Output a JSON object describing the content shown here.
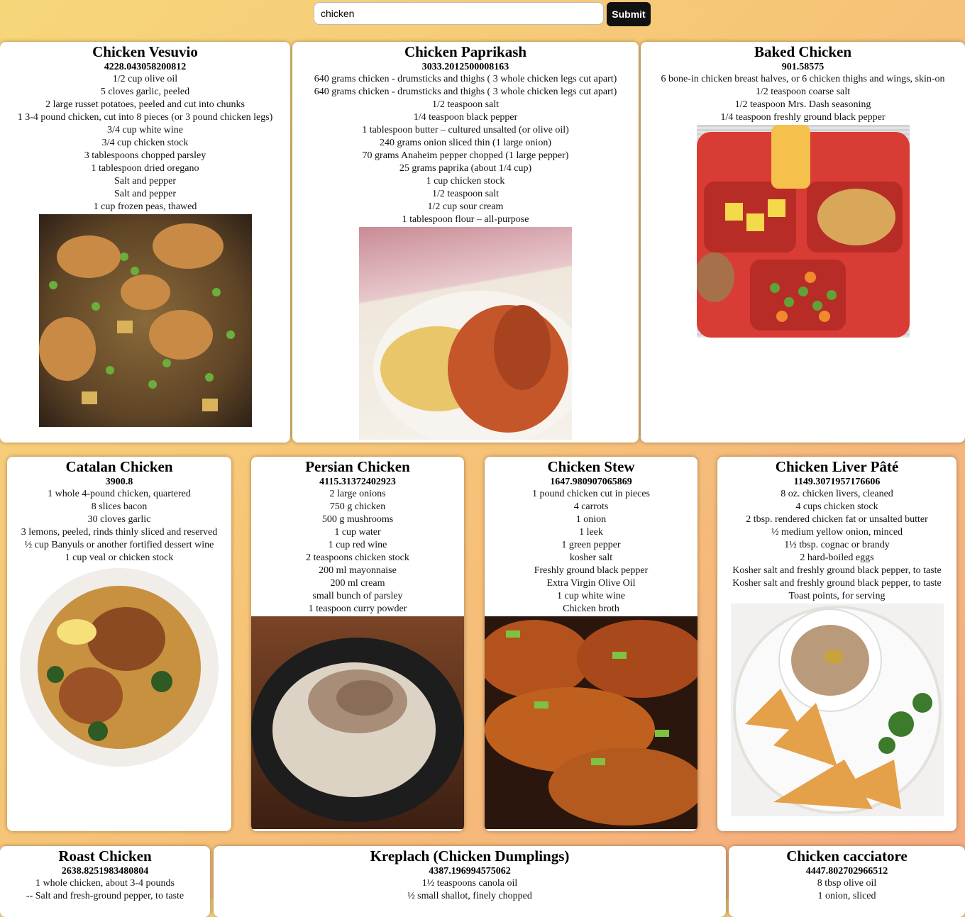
{
  "search": {
    "value": "chicken",
    "submit_label": "Submit"
  },
  "recipes": [
    {
      "title": "Chicken Vesuvio",
      "score": "4228.043058200812",
      "ingredients": [
        "1/2 cup olive oil",
        "5 cloves garlic, peeled",
        "2 large russet potatoes, peeled and cut into chunks",
        "1 3-4 pound chicken, cut into 8 pieces (or 3 pound chicken legs)",
        "3/4 cup white wine",
        "3/4 cup chicken stock",
        "3 tablespoons chopped parsley",
        "1 tablespoon dried oregano",
        "Salt and pepper",
        "Salt and pepper",
        "1 cup frozen peas, thawed"
      ]
    },
    {
      "title": "Chicken Paprikash",
      "score": "3033.2012500008163",
      "ingredients": [
        "640 grams chicken - drumsticks and thighs ( 3 whole chicken legs cut apart)",
        "640 grams chicken - drumsticks and thighs ( 3 whole chicken legs cut apart)",
        "1/2 teaspoon salt",
        "1/4 teaspoon black pepper",
        "1 tablespoon butter – cultured unsalted (or olive oil)",
        "240 grams onion sliced thin (1 large onion)",
        "70 grams Anaheim pepper chopped (1 large pepper)",
        "25 grams paprika (about 1/4 cup)",
        "1 cup chicken stock",
        "1/2 teaspoon salt",
        "1/2 cup sour cream",
        "1 tablespoon flour – all-purpose"
      ]
    },
    {
      "title": "Baked Chicken",
      "score": "901.58575",
      "ingredients": [
        "6 bone-in chicken breast halves, or 6 chicken thighs and wings, skin-on",
        "1/2 teaspoon coarse salt",
        "1/2 teaspoon Mrs. Dash seasoning",
        "1/4 teaspoon freshly ground black pepper"
      ]
    },
    {
      "title": "Catalan Chicken",
      "score": "3900.8",
      "ingredients": [
        "1 whole 4-pound chicken, quartered",
        "8 slices bacon",
        "30 cloves garlic",
        "3 lemons, peeled, rinds thinly sliced and reserved",
        "½ cup Banyuls or another fortified dessert wine",
        "1 cup veal or chicken stock"
      ]
    },
    {
      "title": "Persian Chicken",
      "score": "4115.31372402923",
      "ingredients": [
        "2 large onions",
        "750 g chicken",
        "500 g mushrooms",
        "1 cup water",
        "1 cup red wine",
        "2 teaspoons chicken stock",
        "200 ml mayonnaise",
        "200 ml cream",
        "small bunch of parsley",
        "1 teaspoon curry powder"
      ]
    },
    {
      "title": "Chicken Stew",
      "score": "1647.980907065869",
      "ingredients": [
        "1 pound chicken cut in pieces",
        "4 carrots",
        "1 onion",
        "1 leek",
        "1 green pepper",
        "kosher salt",
        "Freshly ground black pepper",
        "Extra Virgin Olive Oil",
        "1 cup white wine",
        "Chicken broth"
      ]
    },
    {
      "title": "Chicken Liver Pâté",
      "score": "1149.3071957176606",
      "ingredients": [
        "8 oz. chicken livers, cleaned",
        "4 cups chicken stock",
        "2 tbsp. rendered chicken fat or unsalted butter",
        "½ medium yellow onion, minced",
        "1½ tbsp. cognac or brandy",
        "2 hard-boiled eggs",
        "Kosher salt and freshly ground black pepper, to taste",
        "Kosher salt and freshly ground black pepper, to taste",
        "Toast points, for serving"
      ]
    },
    {
      "title": "Roast Chicken",
      "score": "2638.8251983480804",
      "ingredients": [
        "1 whole chicken, about 3-4 pounds",
        "-- Salt and fresh-ground pepper, to taste"
      ]
    },
    {
      "title": "Kreplach (Chicken Dumplings)",
      "score": "4387.196994575062",
      "ingredients": [
        "1½ teaspoons canola oil",
        "½ small shallot, finely chopped"
      ]
    },
    {
      "title": "Chicken cacciatore",
      "score": "4447.802702966512",
      "ingredients": [
        "8 tbsp olive oil",
        "1 onion, sliced"
      ]
    }
  ]
}
